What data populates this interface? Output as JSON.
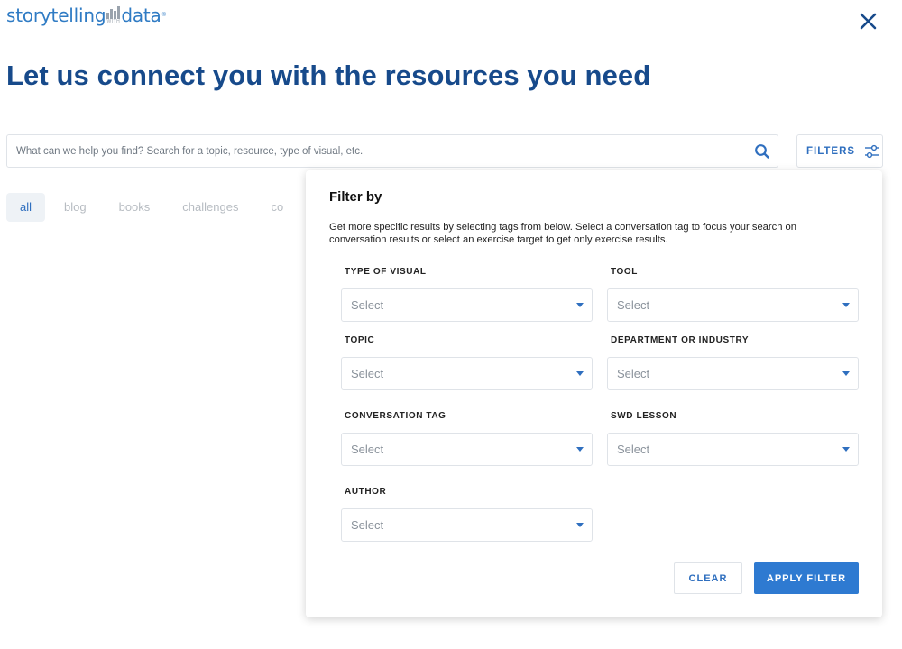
{
  "logo": {
    "word1": "storytelling",
    "with": "WITH",
    "word2": "data",
    "reg": "®"
  },
  "header": {
    "title": "Let us connect you with the resources you need"
  },
  "search": {
    "placeholder": "What can we help you find? Search for a topic, resource, type of visual, etc.",
    "value": ""
  },
  "filters_button": {
    "label": "FILTERS"
  },
  "tabs": [
    {
      "label": "all",
      "active": true
    },
    {
      "label": "blog",
      "active": false
    },
    {
      "label": "books",
      "active": false
    },
    {
      "label": "challenges",
      "active": false
    },
    {
      "label": "co",
      "active": false
    }
  ],
  "filter_panel": {
    "title": "Filter by",
    "description": "Get more specific results by selecting tags from below. Select a conversation tag to focus your search on conversation results or select an exercise target to get only exercise results.",
    "fields": [
      {
        "label": "TYPE OF VISUAL",
        "value": "Select"
      },
      {
        "label": "TOOL",
        "value": "Select"
      },
      {
        "label": "TOPIC",
        "value": "Select"
      },
      {
        "label": "DEPARTMENT OR INDUSTRY",
        "value": "Select"
      },
      {
        "label": "CONVERSATION TAG",
        "value": "Select"
      },
      {
        "label": "SWD LESSON",
        "value": "Select"
      },
      {
        "label": "AUTHOR",
        "value": "Select"
      }
    ],
    "clear_label": "CLEAR",
    "apply_label": "APPLY FILTER"
  },
  "icons": {
    "close": "close-icon",
    "search": "search-icon",
    "filters": "sliders-icon",
    "select_caret": "caret-down-icon"
  },
  "colors": {
    "brand": "#174a8b",
    "accent": "#2e7ad1",
    "link": "#2f6fbf"
  }
}
